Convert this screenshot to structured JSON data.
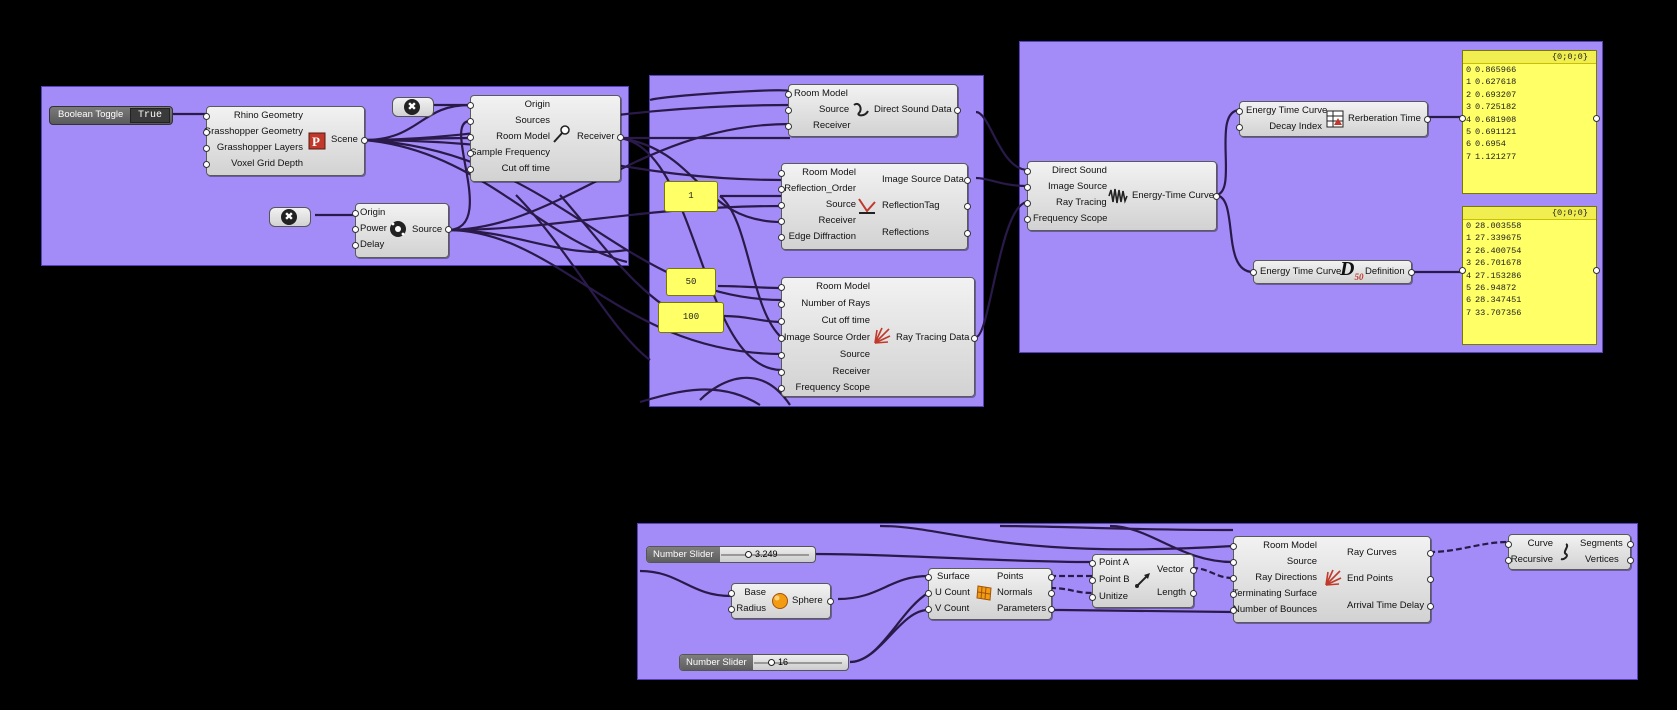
{
  "colors": {
    "canvas": "#000000",
    "group": "#a48cf8",
    "panel": "#ffff66",
    "wire": "#2a1a4a"
  },
  "scene_group": {
    "boolean_toggle": {
      "label": "Boolean Toggle",
      "value": "True"
    },
    "scene": {
      "inputs": [
        "Rhino Geometry",
        "Grasshopper Geometry",
        "Grasshopper Layers",
        "Voxel Grid Depth"
      ],
      "output": "Scene",
      "icon": "scene-p-icon"
    },
    "receiver": {
      "inputs": [
        "Origin",
        "Sources",
        "Room Model",
        "Sample Frequency",
        "Cut off time"
      ],
      "output": "Receiver",
      "icon": "microphone-icon"
    },
    "source": {
      "inputs": [
        "Origin",
        "Power",
        "Delay"
      ],
      "output": "Source",
      "icon": "speaker-icon"
    }
  },
  "simulation_group": {
    "direct_sound": {
      "inputs": [
        "Room Model",
        "Source",
        "Receiver"
      ],
      "output": "Direct Sound Data",
      "icon": "squiggle-icon"
    },
    "image_source": {
      "inputs": [
        "Room Model",
        "Reflection_Order",
        "Source",
        "Receiver",
        "Edge Diffraction"
      ],
      "outputs": [
        "Image Source Data",
        "ReflectionTag",
        "Reflections"
      ],
      "icon": "reflection-icon"
    },
    "ray_tracing": {
      "inputs": [
        "Room Model",
        "Number of Rays",
        "Cut off time",
        "Image Source Order",
        "Source",
        "Receiver",
        "Frequency Scope"
      ],
      "output": "Ray Tracing Data",
      "icon": "rays-icon"
    },
    "panels": {
      "order": "1",
      "value_50": "50",
      "value_100": "100"
    }
  },
  "analysis_group": {
    "etc": {
      "inputs": [
        "Direct Sound",
        "Image Source",
        "Ray Tracing",
        "Frequency Scope"
      ],
      "output": "Energy-Time Curve",
      "icon": "waveform-icon"
    },
    "reverb": {
      "inputs": [
        "Energy Time Curve",
        "Decay Index"
      ],
      "output": "Rerberation Time",
      "icon": "table-chart-icon"
    },
    "definition": {
      "input": "Energy Time Curve",
      "output": "Definition",
      "icon": "d50-icon",
      "icon_text": "D",
      "icon_sub": "50"
    },
    "panel_reverb": {
      "header": "{0;0;0}",
      "rows": [
        {
          "i": "0",
          "v": "0.865966"
        },
        {
          "i": "1",
          "v": "0.627618"
        },
        {
          "i": "2",
          "v": "0.693207"
        },
        {
          "i": "3",
          "v": "0.725182"
        },
        {
          "i": "4",
          "v": "0.681908"
        },
        {
          "i": "5",
          "v": "0.691121"
        },
        {
          "i": "6",
          "v": "0.6954"
        },
        {
          "i": "7",
          "v": "1.121277"
        }
      ]
    },
    "panel_definition": {
      "header": "{0;0;0}",
      "rows": [
        {
          "i": "0",
          "v": "28.003558"
        },
        {
          "i": "1",
          "v": "27.339675"
        },
        {
          "i": "2",
          "v": "26.400754"
        },
        {
          "i": "3",
          "v": "26.701678"
        },
        {
          "i": "4",
          "v": "27.153286"
        },
        {
          "i": "5",
          "v": "26.94872"
        },
        {
          "i": "6",
          "v": "28.347451"
        },
        {
          "i": "7",
          "v": "33.707356"
        }
      ]
    }
  },
  "rays_group": {
    "slider1": {
      "label": "Number Slider",
      "value": "3.249",
      "fraction": 0.24
    },
    "slider2": {
      "label": "Number Slider",
      "value": "16",
      "fraction": 0.1
    },
    "sphere": {
      "inputs": [
        "Base",
        "Radius"
      ],
      "output": "Sphere",
      "icon": "sphere-icon"
    },
    "divide": {
      "inputs": [
        "Surface",
        "U Count",
        "V Count"
      ],
      "outputs": [
        "Points",
        "Normals",
        "Parameters"
      ],
      "icon": "surface-grid-icon"
    },
    "vector": {
      "inputs": [
        "Point A",
        "Point B",
        "Unitize"
      ],
      "outputs": [
        "Vector",
        "Length"
      ],
      "icon": "vector-arrow-icon"
    },
    "ray_curves": {
      "inputs": [
        "Room Model",
        "Source",
        "Ray Directions",
        "Terminating Surface",
        "Number of Bounces"
      ],
      "outputs": [
        "Ray Curves",
        "End Points",
        "Arrival Time Delay"
      ],
      "icon": "ray-curves-icon"
    },
    "explode": {
      "inputs": [
        "Curve",
        "Recursive"
      ],
      "outputs": [
        "Segments",
        "Vertices"
      ],
      "icon": "explode-curve-icon"
    }
  }
}
